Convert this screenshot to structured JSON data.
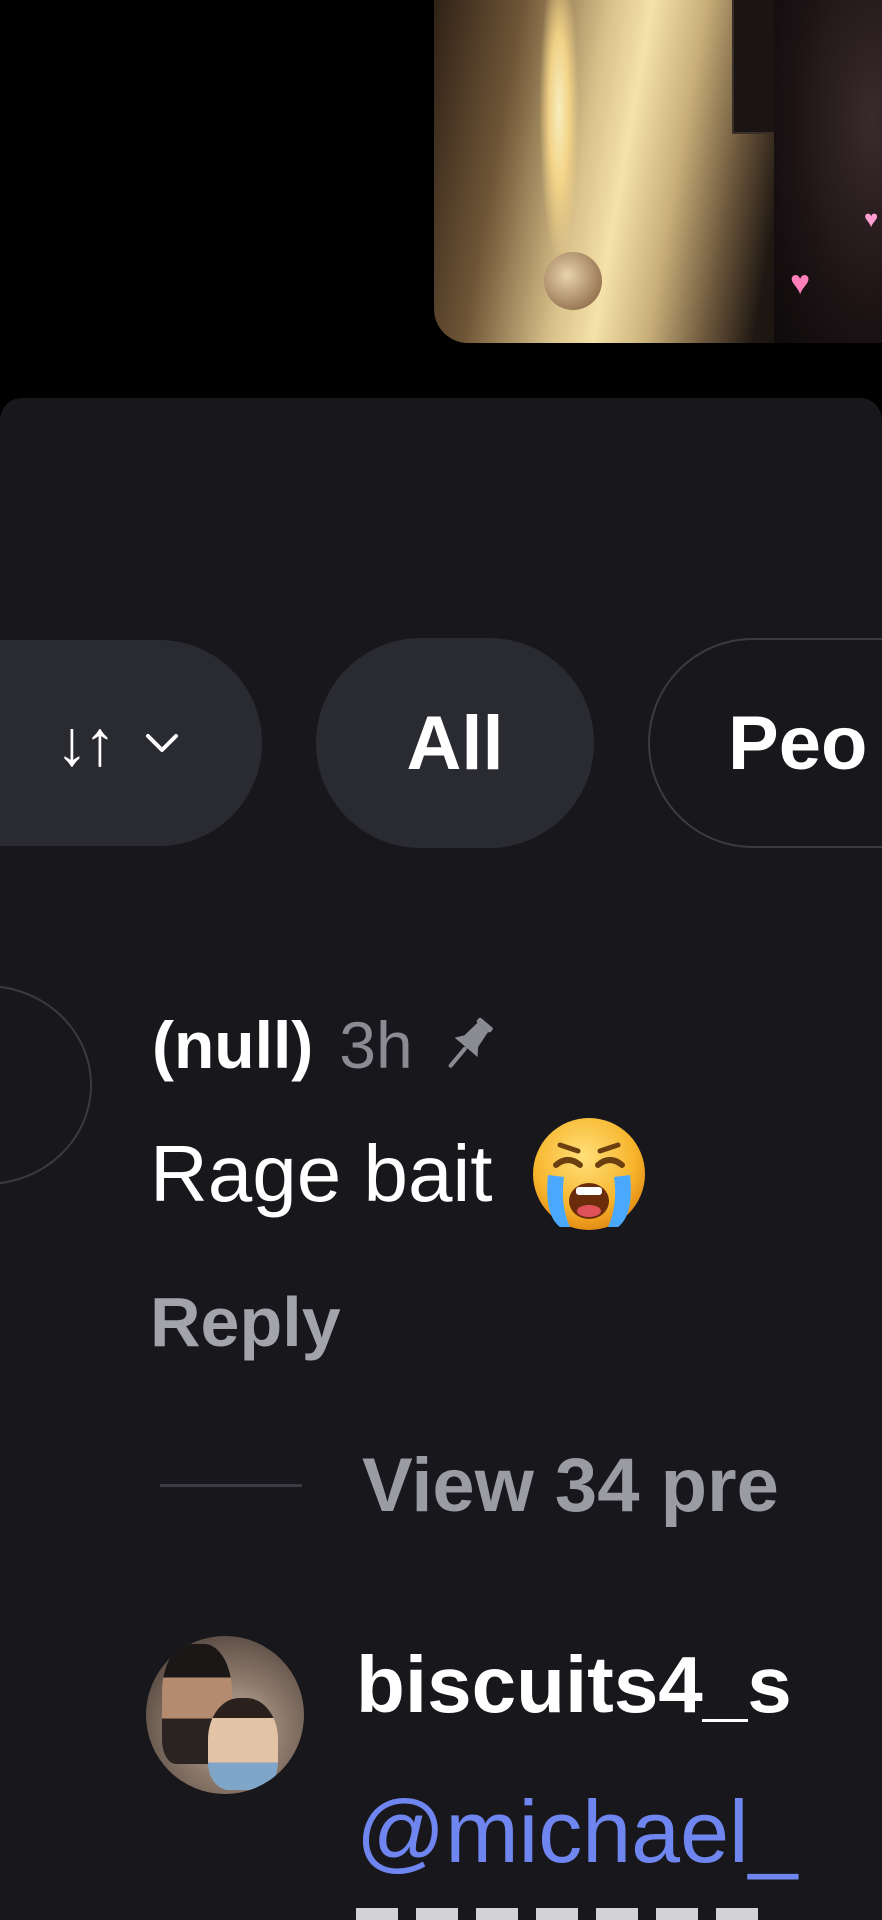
{
  "filters": {
    "sort_icon": "↓↑",
    "sort_chevron": "chevron-down-icon",
    "all_label": "All",
    "people_label": "Peo"
  },
  "comment": {
    "username": "(null)",
    "time": "3h",
    "pin_icon": "pin-icon",
    "text": "Rage bait",
    "emoji": "loudly-crying-face-emoji",
    "reply_label": "Reply",
    "view_replies_label": "View 34 pre"
  },
  "comment2": {
    "username": "biscuits4_s",
    "mention": "@michael_"
  },
  "colors": {
    "background": "#000000",
    "sheet": "#18181c",
    "chip": "#2a2b31",
    "muted_text": "#8a8b93",
    "mention": "#6f86f0"
  }
}
